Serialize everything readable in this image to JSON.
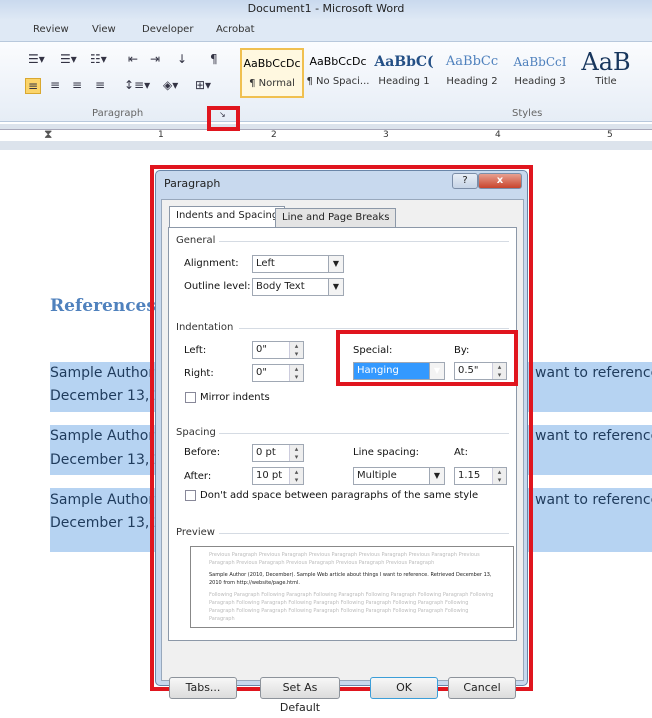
{
  "window": {
    "title": "Document1 - Microsoft Word"
  },
  "ribbon_tabs": [
    "Review",
    "View",
    "Developer",
    "Acrobat"
  ],
  "ribbon": {
    "paragraph_group": "Paragraph",
    "styles_group": "Styles",
    "styles": [
      {
        "sample": "AaBbCcDc",
        "name": "¶ Normal"
      },
      {
        "sample": "AaBbCcDc",
        "name": "¶ No Spaci..."
      },
      {
        "sample": "AaBbC(",
        "name": "Heading 1"
      },
      {
        "sample": "AaBbCc",
        "name": "Heading 2"
      },
      {
        "sample": "AaBbCcI",
        "name": "Heading 3"
      },
      {
        "sample": "AaB",
        "name": "Title"
      }
    ]
  },
  "ruler": [
    "1",
    "2",
    "3",
    "4",
    "5"
  ],
  "document": {
    "heading": "References",
    "lines": [
      [
        "Sample Author",
        "want to reference",
        "December 13, 2"
      ],
      [
        "Sample Author",
        "want to reference",
        "December 13, 2"
      ],
      [
        "Sample Author",
        "want to reference",
        "December 13, 2"
      ]
    ]
  },
  "dialog": {
    "title": "Paragraph",
    "help": "?",
    "close": "x",
    "tabs": [
      "Indents and Spacing",
      "Line and Page Breaks"
    ],
    "general": {
      "title": "General",
      "alignment_label": "Alignment:",
      "alignment": "Left",
      "outline_label": "Outline level:",
      "outline": "Body Text"
    },
    "indentation": {
      "title": "Indentation",
      "left_label": "Left:",
      "left": "0\"",
      "right_label": "Right:",
      "right": "0\"",
      "special_label": "Special:",
      "special": "Hanging",
      "by_label": "By:",
      "by": "0.5\"",
      "mirror": "Mirror indents"
    },
    "spacing": {
      "title": "Spacing",
      "before_label": "Before:",
      "before": "0 pt",
      "after_label": "After:",
      "after": "10 pt",
      "line_label": "Line spacing:",
      "line": "Multiple",
      "at_label": "At:",
      "at": "1.15",
      "dont_add": "Don't add space between paragraphs of the same style"
    },
    "preview": {
      "title": "Preview",
      "previous": "Previous Paragraph Previous Paragraph Previous Paragraph Previous Paragraph Previous Paragraph Previous Paragraph Previous Paragraph Previous Paragraph Previous Paragraph Previous Paragraph",
      "current": "Sample Author (2010, December).  Sample Web article about things I want to reference.  Retrieved December 13, 2010 from http://website/page.html.",
      "following": "Following Paragraph Following Paragraph Following Paragraph Following Paragraph Following Paragraph Following Paragraph Following Paragraph Following Paragraph Following Paragraph Following Paragraph Following Paragraph Following Paragraph Following Paragraph Following Paragraph Following Paragraph Following Paragraph"
    },
    "buttons": {
      "tabs": "Tabs...",
      "default": "Set As Default",
      "ok": "OK",
      "cancel": "Cancel"
    }
  }
}
